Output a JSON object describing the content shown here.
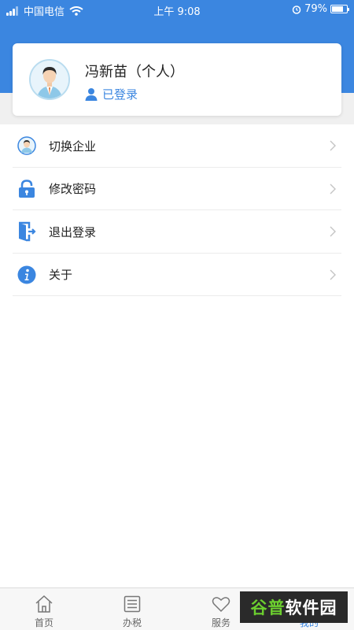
{
  "status_bar": {
    "carrier": "中国电信",
    "time": "上午 9:08",
    "battery": "79%",
    "battery_level": 0.79
  },
  "profile": {
    "name": "冯新苗（个人）",
    "status": "已登录",
    "avatar_icon": "user-avatar-icon"
  },
  "menu": {
    "items": [
      {
        "label": "切换企业",
        "icon": "switch-company-icon"
      },
      {
        "label": "修改密码",
        "icon": "lock-icon"
      },
      {
        "label": "退出登录",
        "icon": "logout-door-icon"
      },
      {
        "label": "关于",
        "icon": "info-icon"
      }
    ]
  },
  "tab_bar": {
    "tabs": [
      {
        "label": "首页",
        "icon": "home-icon"
      },
      {
        "label": "办税",
        "icon": "list-icon"
      },
      {
        "label": "服务",
        "icon": "heart-icon"
      },
      {
        "label": "我的",
        "icon": "person-icon",
        "active": true
      }
    ]
  },
  "watermark": {
    "text_a": "谷普",
    "text_b": "软件园"
  },
  "colors": {
    "primary": "#3b86e0",
    "background": "#ffffff",
    "band_gray": "#f0f0f0"
  }
}
